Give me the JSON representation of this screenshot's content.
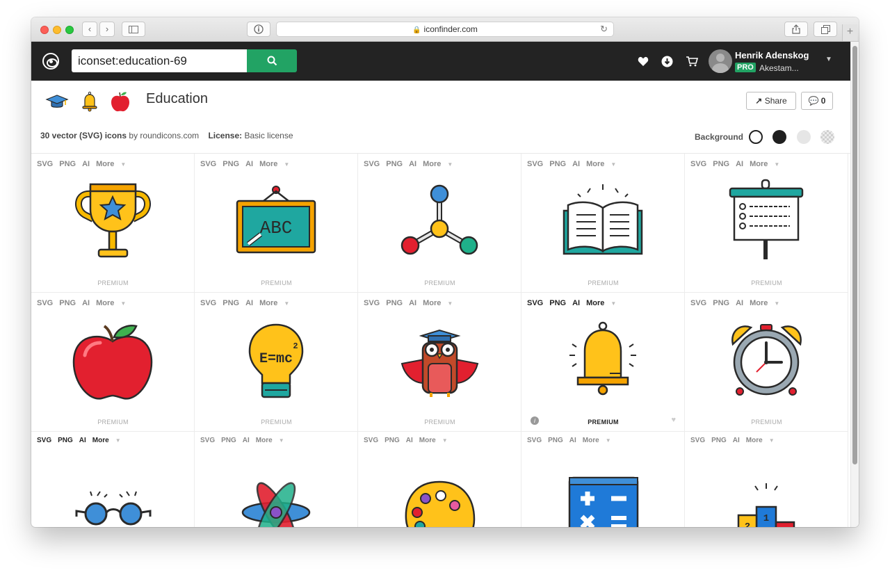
{
  "browser": {
    "url": "iconfinder.com",
    "new_tab": "+"
  },
  "navbar": {
    "search_value": "iconset:education-69",
    "user_name": "Henrik Adenskog",
    "pro_badge": "PRO",
    "user_org": "Akestam..."
  },
  "set": {
    "title": "Education",
    "count_text": "30 vector (SVG) icons",
    "by_text": "by roundicons.com",
    "license_label": "License:",
    "license_value": "Basic license",
    "share_label": "Share",
    "comment_count": "0",
    "background_label": "Background"
  },
  "formats": [
    "SVG",
    "PNG",
    "AI",
    "More"
  ],
  "premium_label": "PREMIUM",
  "icons": [
    {
      "name": "trophy-icon"
    },
    {
      "name": "abc-board-icon"
    },
    {
      "name": "molecule-icon"
    },
    {
      "name": "open-book-icon"
    },
    {
      "name": "presentation-board-icon"
    },
    {
      "name": "apple-icon"
    },
    {
      "name": "light-bulb-icon"
    },
    {
      "name": "owl-icon"
    },
    {
      "name": "bell-icon"
    },
    {
      "name": "alarm-clock-icon"
    },
    {
      "name": "glasses-icon"
    },
    {
      "name": "atom-icon"
    },
    {
      "name": "palette-icon"
    },
    {
      "name": "calculator-icon"
    },
    {
      "name": "podium-icon"
    }
  ],
  "colors": {
    "brand_green": "#22a364",
    "navbar_bg": "#232323"
  }
}
